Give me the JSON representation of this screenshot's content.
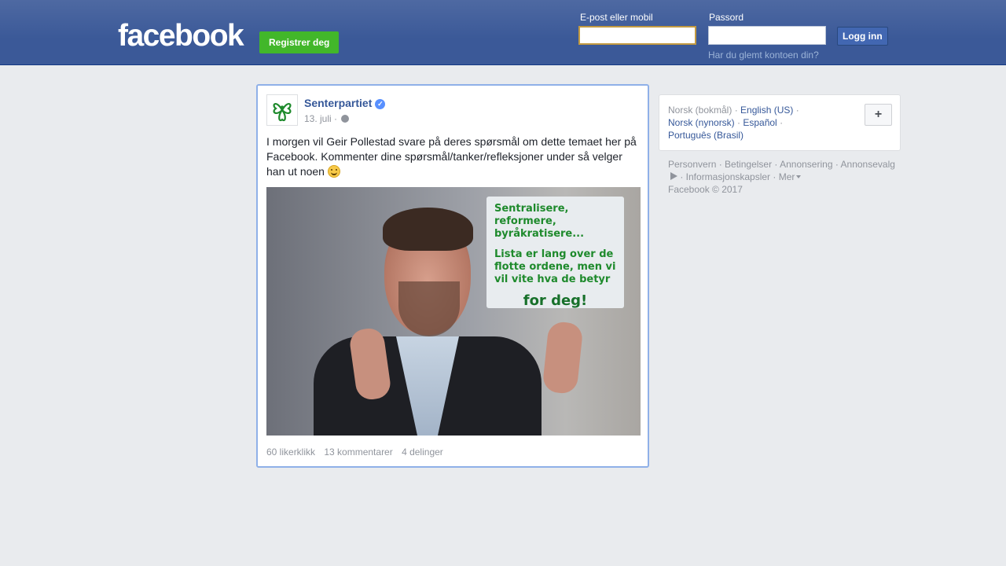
{
  "header": {
    "logo": "facebook",
    "signup_label": "Registrer deg",
    "email_label": "E-post eller mobil",
    "email_value": "",
    "password_label": "Passord",
    "password_value": "",
    "login_label": "Logg inn",
    "forgot_label": "Har du glemt kontoen din?"
  },
  "post": {
    "page_name": "Senterpartiet",
    "verified": true,
    "date": "13. juli",
    "text": "I morgen vil Geir Pollestad svare på deres spørsmål om dette temaet her på Facebook. Kommenter dine spørsmål/tanker/refleksjoner under så velger han ut noen",
    "image_sign": {
      "line1": "Sentralisere, reformere, byråkratisere...",
      "line2": "Lista er lang over de flotte ordene, men vi vil vite hva de betyr",
      "line3": "for deg!"
    },
    "likes": "60 likerklikk",
    "comments": "13 kommentarer",
    "shares": "4 delinger"
  },
  "languages": {
    "current": "Norsk (bokmål)",
    "items": [
      "English (US)",
      "Norsk (nynorsk)",
      "Español",
      "Português (Brasil)"
    ],
    "more_button": "+"
  },
  "footer": {
    "links": [
      "Personvern",
      "Betingelser",
      "Annonsering",
      "Annonsevalg",
      "Informasjonskapsler",
      "Mer"
    ],
    "copyright": "Facebook © 2017"
  },
  "colors": {
    "header_blue": "#3b5998",
    "signup_green": "#42b72a",
    "link_blue": "#365899",
    "brand_green": "#1e8a2c"
  }
}
